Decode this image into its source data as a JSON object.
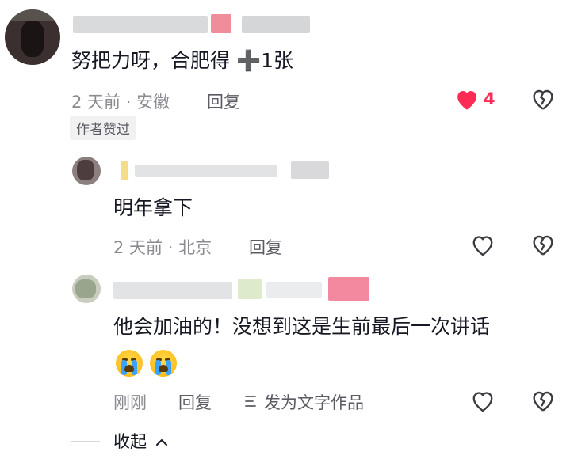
{
  "comments": [
    {
      "text": "努把力呀，合肥得 ➕1张",
      "time": "2 天前",
      "location": "安徽",
      "meta_sep": "·",
      "reply_label": "回复",
      "likes": "4",
      "liked": true,
      "author_badge": "作者赞过"
    },
    {
      "text": "明年拿下",
      "time": "2 天前",
      "location": "北京",
      "meta_sep": "·",
      "reply_label": "回复"
    },
    {
      "text": "他会加油的！没想到这是生前最后一次讲话",
      "emoji": [
        "crying-face",
        "crying-face"
      ],
      "time": "刚刚",
      "reply_label": "回复",
      "post_as_text_label": "发为文字作品"
    }
  ],
  "collapse_label": "收起",
  "colors": {
    "accent_like": "#fe2c55",
    "muted": "#8a8b91",
    "text": "#161823"
  }
}
